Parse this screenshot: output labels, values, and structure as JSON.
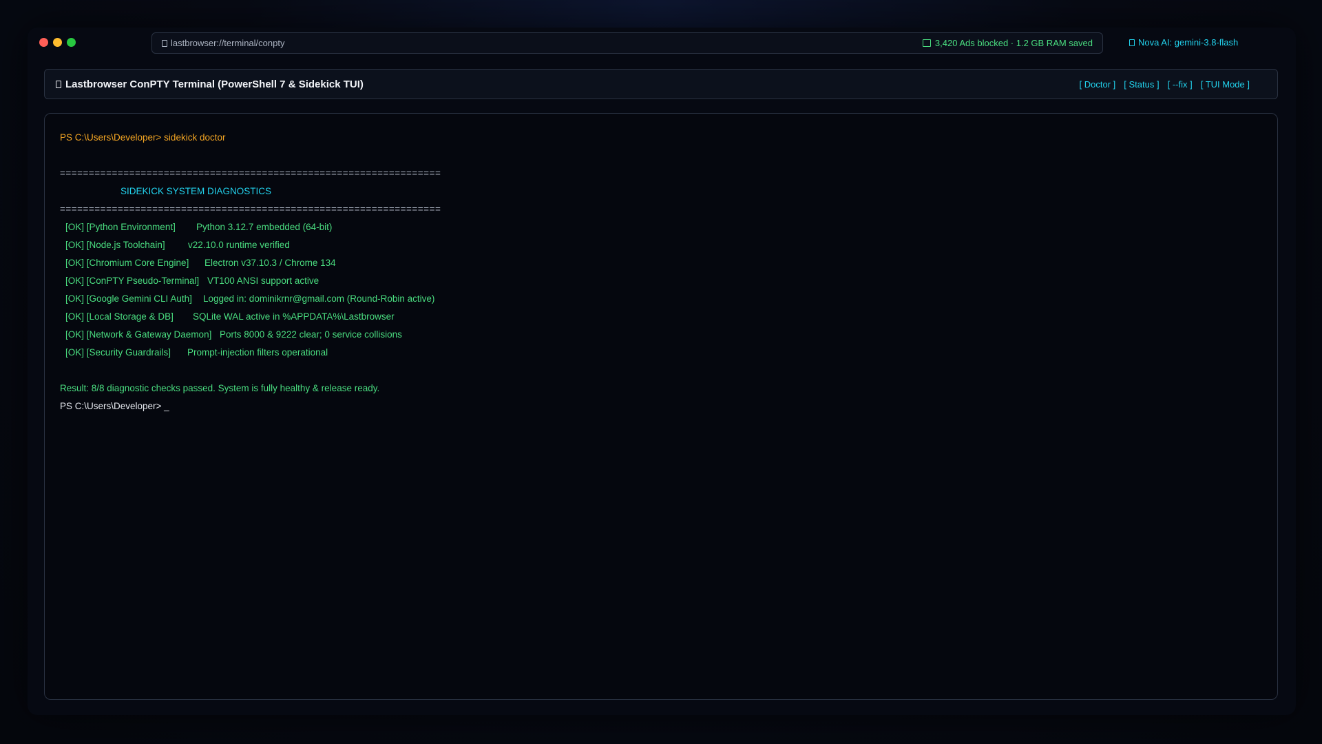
{
  "titlebar": {
    "url": "lastbrowser://terminal/conpty",
    "adblock_status": "3,420 Ads blocked · 1.2 GB RAM saved",
    "ai_badge": "Nova AI: gemini-3.8-flash"
  },
  "header": {
    "title": "Lastbrowser ConPTY Terminal (PowerShell 7 & Sidekick TUI)",
    "actions": [
      {
        "label": "[ Doctor ]"
      },
      {
        "label": "[ Status ]"
      },
      {
        "label": "[ --fix ]"
      },
      {
        "label": "[ TUI Mode ]"
      }
    ]
  },
  "terminal": {
    "command_line": "PS C:\\Users\\Developer> sidekick doctor",
    "separator": "==================================================================",
    "banner": "SIDEKICK SYSTEM DIAGNOSTICS",
    "checks": [
      {
        "label": "[OK] [Python Environment]",
        "detail": "Python 3.12.7 embedded (64-bit)"
      },
      {
        "label": "[OK] [Node.js Toolchain]",
        "detail": "v22.10.0 runtime verified"
      },
      {
        "label": "[OK] [Chromium Core Engine]",
        "detail": "Electron v37.10.3 / Chrome 134"
      },
      {
        "label": "[OK] [ConPTY Pseudo-Terminal]",
        "detail": "VT100 ANSI support active"
      },
      {
        "label": "[OK] [Google Gemini CLI Auth]",
        "detail": "Logged in: dominikrnr@gmail.com (Round-Robin active)"
      },
      {
        "label": "[OK] [Local Storage & DB]",
        "detail": "SQLite WAL active in %APPDATA%\\Lastbrowser"
      },
      {
        "label": "[OK] [Network & Gateway Daemon]",
        "detail": "Ports 8000 & 9222 clear; 0 service collisions"
      },
      {
        "label": "[OK] [Security Guardrails]",
        "detail": "Prompt-injection filters operational"
      }
    ],
    "result": "Result: 8/8 diagnostic checks passed. System is fully healthy & release ready.",
    "final_prompt": "PS C:\\Users\\Developer> _"
  },
  "colors": {
    "accent_cyan": "#22d3ee",
    "ok_green": "#4ade80",
    "prompt_orange": "#f5a623"
  }
}
